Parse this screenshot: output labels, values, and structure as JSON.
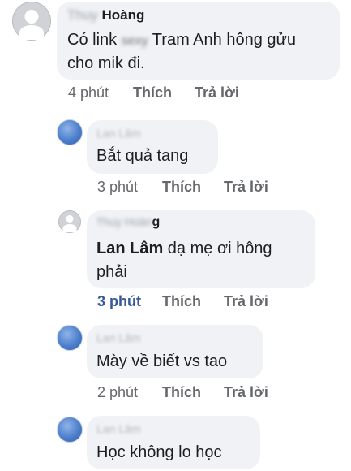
{
  "comments": [
    {
      "author_blurred": "Thuy",
      "author_name": "Hoàng",
      "line1_pre": "Có link ",
      "line1_blur": "sexy",
      "line1_post": " Tram Anh hông gửu",
      "line2": "cho mik đi.",
      "time": "4 phút",
      "like": "Thích",
      "reply": "Trả lời"
    },
    {
      "author": "Lan Lâm",
      "text": "Bắt quả tang",
      "time": "3 phút",
      "like": "Thích",
      "reply": "Trả lời"
    },
    {
      "author_blurred": "Thuy Hoàn",
      "author_tail": "g",
      "mention": "Lan Lâm",
      "line1_rest": " dạ mẹ ơi hông",
      "line2": "phải",
      "time": "3 phút",
      "like": "Thích",
      "reply": "Trả lời"
    },
    {
      "author": "Lan Lâm",
      "text": "Mày về biết vs tao",
      "time": "2 phút",
      "like": "Thích",
      "reply": "Trả lời"
    },
    {
      "author": "Lan Lâm",
      "text": "Học không lo học"
    }
  ]
}
